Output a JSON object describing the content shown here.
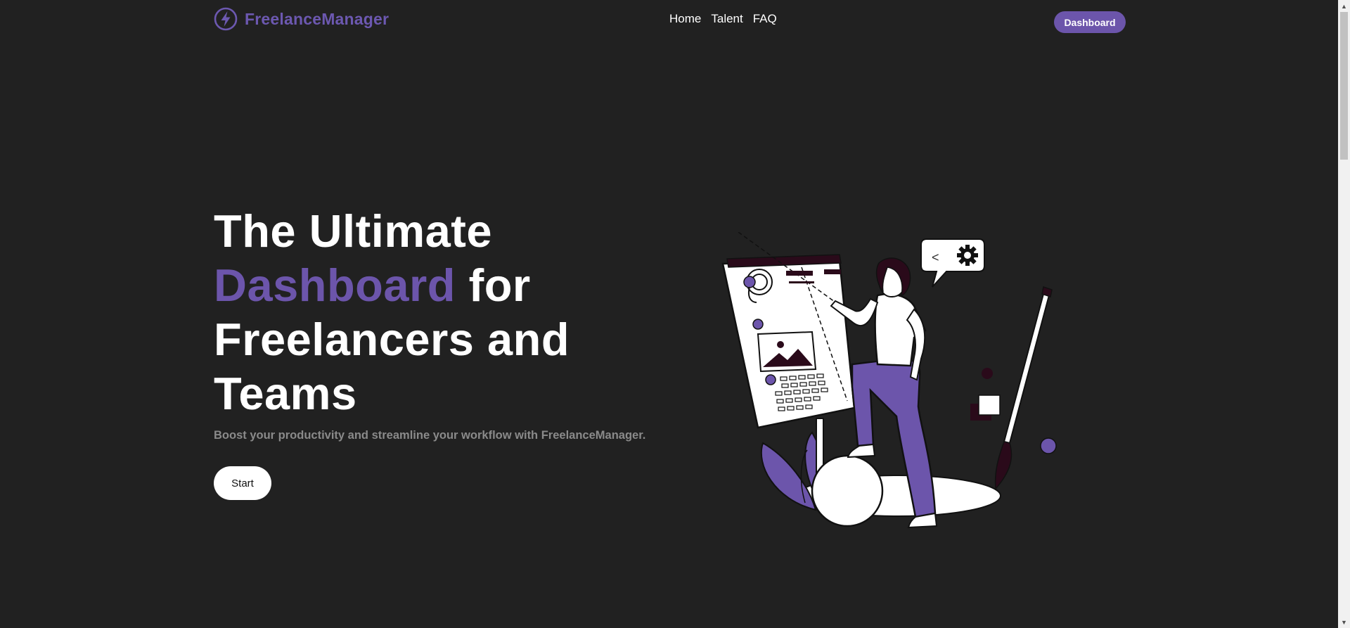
{
  "header": {
    "brand_name": "FreelanceManager",
    "nav": [
      "Home",
      "Talent",
      "FAQ"
    ],
    "dashboard_label": "Dashboard"
  },
  "hero": {
    "headline_part1": "The Ultimate",
    "headline_accent": "Dashboard",
    "headline_part2": " for",
    "headline_part3": "Freelancers and",
    "headline_part4": "Teams",
    "subtitle": "Boost your productivity and streamline your workflow with FreelanceManager.",
    "start_label": "Start"
  },
  "illustration": {
    "bubble_glyph": "<"
  },
  "colors": {
    "background": "#212121",
    "accent": "#6c55ab",
    "brand": "#6c58b0",
    "text": "#ffffff",
    "muted": "#8a8a8a"
  },
  "icons": [
    "lightning-bolt-icon",
    "gear-icon",
    "scroll-up-arrow-icon",
    "scroll-down-arrow-icon"
  ]
}
